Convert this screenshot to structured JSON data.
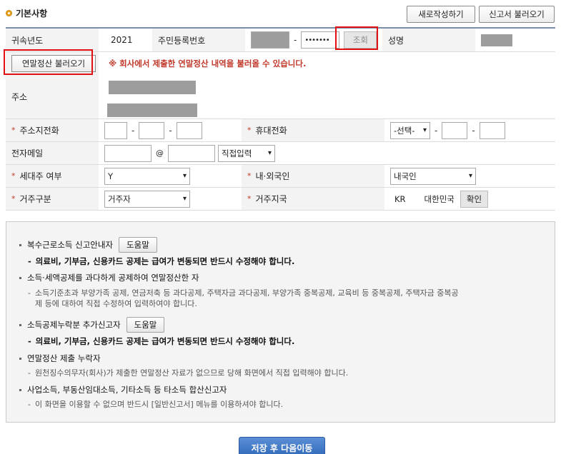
{
  "section": {
    "title": "기본사항"
  },
  "top_buttons": {
    "new": "새로작성하기",
    "load": "신고서 불러오기"
  },
  "form": {
    "year_label": "귀속년도",
    "year_value": "2021",
    "rrn_label": "주민등록번호",
    "rrn_masked": "•••••••",
    "lookup_btn": "조회",
    "name_label": "성명",
    "load_settlement_btn": "연말정산 불러오기",
    "load_notice": "※ 회사에서 제출한 연말정산 내역을 불러올 수 있습니다.",
    "address_label": "주소",
    "home_phone_label": "주소지전화",
    "mobile_label": "휴대전화",
    "mobile_select": "-선택-",
    "email_label": "전자메일",
    "email_at": "@",
    "email_domain_select": "직접입력",
    "householder_label": "세대주 여부",
    "householder_value": "Y",
    "nationality_label": "내·외국인",
    "nationality_value": "내국인",
    "residency_label": "거주구분",
    "residency_value": "거주자",
    "residence_country_label": "거주지국",
    "country_code": "KR",
    "country_name": "대한민국",
    "confirm_btn": "확인"
  },
  "notice": {
    "item1": "복수근로소득 신고안내자",
    "item1_help": "도움말",
    "item1_sub": "의료비, 기부금, 신용카드 공제는 급여가 변동되면 반드시 수정해야 합니다.",
    "item2": "소득·세액공제를 과다하게 공제하여 연말정산한 자",
    "item2_sub_line1": "소득기준초과 부양가족 공제, 연금저축 등 과다공제, 주택자금 과다공제, 부양가족 중복공제, 교육비 등 중복공제, 주택자금 중복공",
    "item2_sub_line2": "제 등에 대하여 직접 수정하여 입력하여야 합니다.",
    "item3": "소득공제누락분 추가신고자",
    "item3_help": "도움말",
    "item3_sub": "의료비, 기부금, 신용카드 공제는 급여가 변동되면 반드시 수정해야 합니다.",
    "item4": "연말정산 제출 누락자",
    "item4_sub": "원천징수의무자(회사)가 제출한 연말정산 자료가 없으므로 당해 화면에서 직접 입력해야 합니다.",
    "item5": "사업소득, 부동산임대소득, 기타소득 등 타소득 합산신고자",
    "item5_sub": "이 화면을 이용할 수 없으며 반드시 [일반신고서] 메뉴를 이용하셔야 합니다."
  },
  "save_btn": "저장 후 다음이동",
  "colors": {
    "highlight": "#e21010",
    "primary": "#2f68b8",
    "required": "#c0392b",
    "notice_text": "#c0392b"
  }
}
